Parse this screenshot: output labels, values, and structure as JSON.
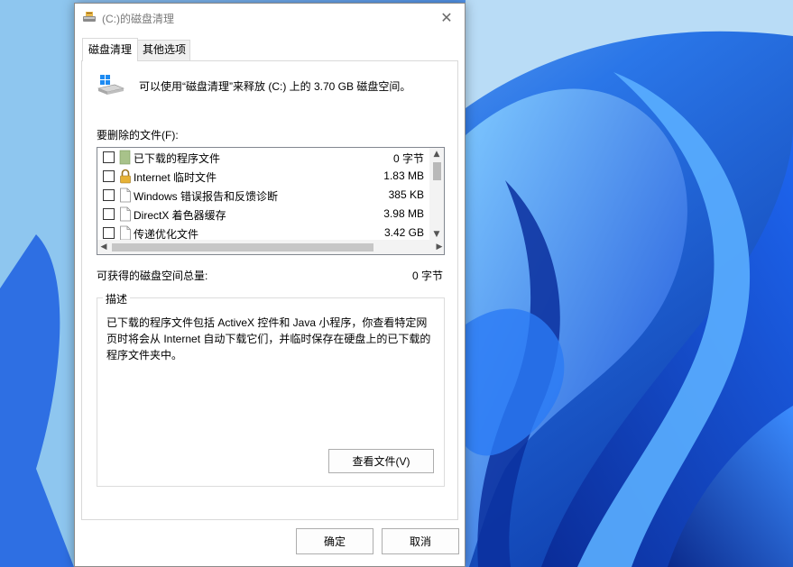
{
  "window": {
    "title": "(C:)的磁盘清理",
    "close_glyph": "✕"
  },
  "tabs": [
    {
      "label": "磁盘清理",
      "active": true
    },
    {
      "label": "其他选项",
      "active": false
    }
  ],
  "summary": {
    "text": "可以使用“磁盘清理”来释放 (C:) 上的 3.70 GB 磁盘空间。"
  },
  "files_label": "要删除的文件(F):",
  "files": [
    {
      "name": "已下载的程序文件",
      "size": "0 字节",
      "checked": false,
      "icon": "downloaded-programs-icon"
    },
    {
      "name": "Internet 临时文件",
      "size": "1.83 MB",
      "checked": false,
      "icon": "lock-icon"
    },
    {
      "name": "Windows 错误报告和反馈诊断",
      "size": "385 KB",
      "checked": false,
      "icon": "document-icon"
    },
    {
      "name": "DirectX 着色器缓存",
      "size": "3.98 MB",
      "checked": false,
      "icon": "document-icon"
    },
    {
      "name": "传递优化文件",
      "size": "3.42 GB",
      "checked": false,
      "icon": "document-icon"
    }
  ],
  "total": {
    "label": "可获得的磁盘空间总量:",
    "value": "0 字节"
  },
  "description": {
    "legend": "描述",
    "text": "已下载的程序文件包括 ActiveX 控件和 Java 小程序，你查看特定网页时将会从 Internet 自动下载它们，并临时保存在硬盘上的已下载的程序文件夹中。",
    "view_files_label": "查看文件(V)"
  },
  "buttons": {
    "ok": "确定",
    "cancel": "取消"
  },
  "colors": {
    "wallpaper_base": "#0a3fb8",
    "wallpaper_light": "#4aa6ff",
    "window_bg": "#ffffff"
  }
}
